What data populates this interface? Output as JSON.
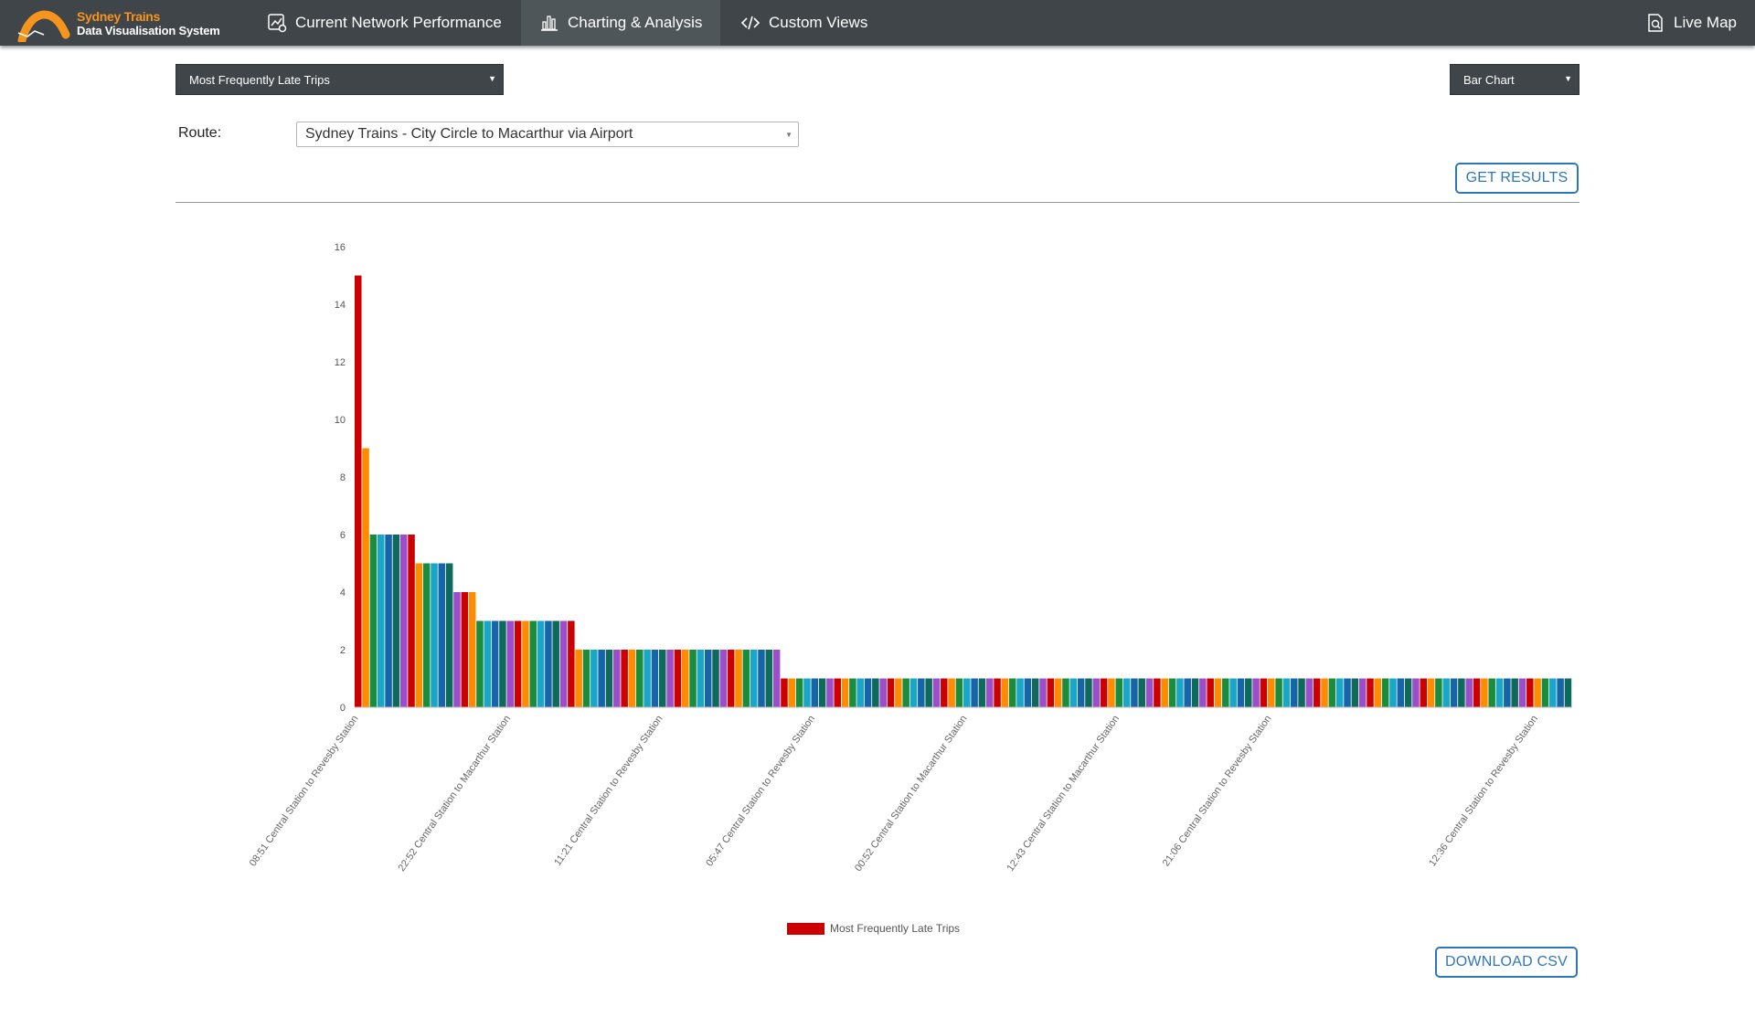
{
  "app": {
    "brand_line1": "Sydney Trains",
    "brand_line2": "Data Visualisation System",
    "brand_color": "#f7941d"
  },
  "nav": {
    "items": [
      {
        "label": "Current Network Performance",
        "icon": "network-performance-icon",
        "active": false
      },
      {
        "label": "Charting & Analysis",
        "icon": "bar-chart-icon",
        "active": true
      },
      {
        "label": "Custom Views",
        "icon": "code-icon",
        "active": false
      }
    ],
    "live_map": {
      "label": "Live Map",
      "icon": "map-document-icon"
    }
  },
  "controls": {
    "report_select": "Most Frequently Late Trips",
    "chart_type_select": "Bar Chart",
    "route_label": "Route:",
    "route_select": "Sydney Trains - City Circle to Macarthur via Airport",
    "get_results": "GET RESULTS",
    "download_csv": "DOWNLOAD CSV"
  },
  "chart_data": {
    "type": "bar",
    "ylim": [
      0,
      16
    ],
    "y_ticks": [
      0,
      2,
      4,
      6,
      8,
      10,
      12,
      14,
      16
    ],
    "legend": "Most Frequently Late Trips",
    "legend_placement": "bottom",
    "grid": false,
    "bar_count": 160,
    "values": [
      15,
      9,
      6,
      6,
      6,
      6,
      6,
      6,
      5,
      5,
      5,
      5,
      5,
      4,
      4,
      4,
      3,
      3,
      3,
      3,
      3,
      3,
      3,
      3,
      3,
      3,
      3,
      3,
      3,
      2,
      2,
      2,
      2,
      2,
      2,
      2,
      2,
      2,
      2,
      2,
      2,
      2,
      2,
      2,
      2,
      2,
      2,
      2,
      2,
      2,
      2,
      2,
      2,
      2,
      2,
      2,
      1,
      1,
      1,
      1,
      1,
      1,
      1,
      1,
      1,
      1,
      1,
      1,
      1,
      1,
      1,
      1,
      1,
      1,
      1,
      1,
      1,
      1,
      1,
      1,
      1,
      1,
      1,
      1,
      1,
      1,
      1,
      1,
      1,
      1,
      1,
      1,
      1,
      1,
      1,
      1,
      1,
      1,
      1,
      1,
      1,
      1,
      1,
      1,
      1,
      1,
      1,
      1,
      1,
      1,
      1,
      1,
      1,
      1,
      1,
      1,
      1,
      1,
      1,
      1,
      1,
      1,
      1,
      1,
      1,
      1,
      1,
      1,
      1,
      1,
      1,
      1,
      1,
      1,
      1,
      1,
      1,
      1,
      1,
      1,
      1,
      1,
      1,
      1,
      1,
      1,
      1,
      1,
      1,
      1,
      1,
      1,
      1,
      1,
      1,
      1,
      1,
      1,
      1,
      1
    ],
    "visible_x_labels": [
      {
        "index": 0,
        "label": "08:51 Central Station to Revesby Station"
      },
      {
        "index": 20,
        "label": "22:52 Central Station to Macarthur Station"
      },
      {
        "index": 40,
        "label": "11:21 Central Station to Revesby Station"
      },
      {
        "index": 60,
        "label": "05:47 Central Station to Revesby Station"
      },
      {
        "index": 80,
        "label": "00:52 Central Station to Macarthur Station"
      },
      {
        "index": 100,
        "label": "12:43 Central Station to Macarthur Station"
      },
      {
        "index": 120,
        "label": "21:06 Central Station to Revesby Station"
      },
      {
        "index": 155,
        "label": "12:36 Central Station to Revesby Station"
      }
    ],
    "bar_colors": [
      "#cc0000",
      "#ff8c00",
      "#1a8c3c",
      "#1aa6c9",
      "#1565a8",
      "#0e6b5c",
      "#9b4dca"
    ]
  }
}
